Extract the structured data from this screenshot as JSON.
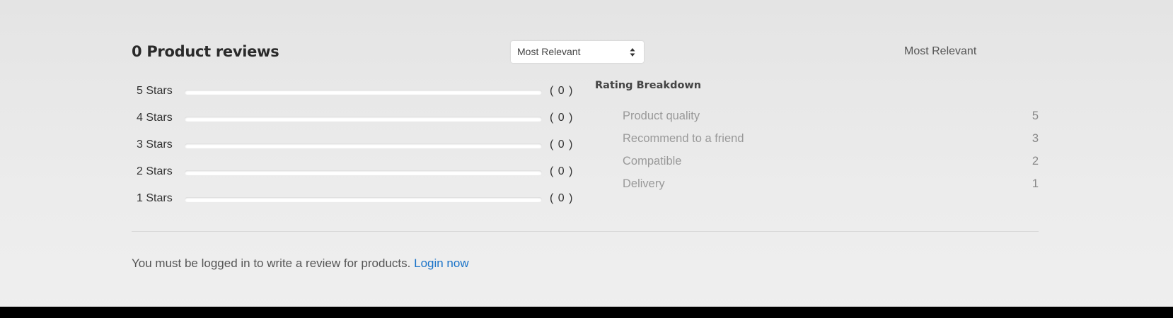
{
  "reviews": {
    "title": "0 Product reviews",
    "sort": {
      "selected": "Most Relevant",
      "label_right": "Most Relevant"
    }
  },
  "rating_bars": [
    {
      "label": "5 Stars",
      "count": "( 0 )",
      "fraction": 0
    },
    {
      "label": "4 Stars",
      "count": "( 0 )",
      "fraction": 0
    },
    {
      "label": "3 Stars",
      "count": "( 0 )",
      "fraction": 0
    },
    {
      "label": "2 Stars",
      "count": "( 0 )",
      "fraction": 0
    },
    {
      "label": "1 Stars",
      "count": "( 0 )",
      "fraction": 0
    }
  ],
  "breakdown": {
    "title": "Rating Breakdown",
    "items": [
      {
        "name": "Product quality",
        "value": "5"
      },
      {
        "name": "Recommend to a friend",
        "value": "3"
      },
      {
        "name": "Compatible",
        "value": "2"
      },
      {
        "name": "Delivery",
        "value": "1"
      }
    ]
  },
  "login_prompt": {
    "text": "You must be logged in to write a review for products.",
    "link_label": "Login now"
  },
  "colors": {
    "link": "#1a73c8",
    "bar_fill": "#f0ad4e"
  }
}
